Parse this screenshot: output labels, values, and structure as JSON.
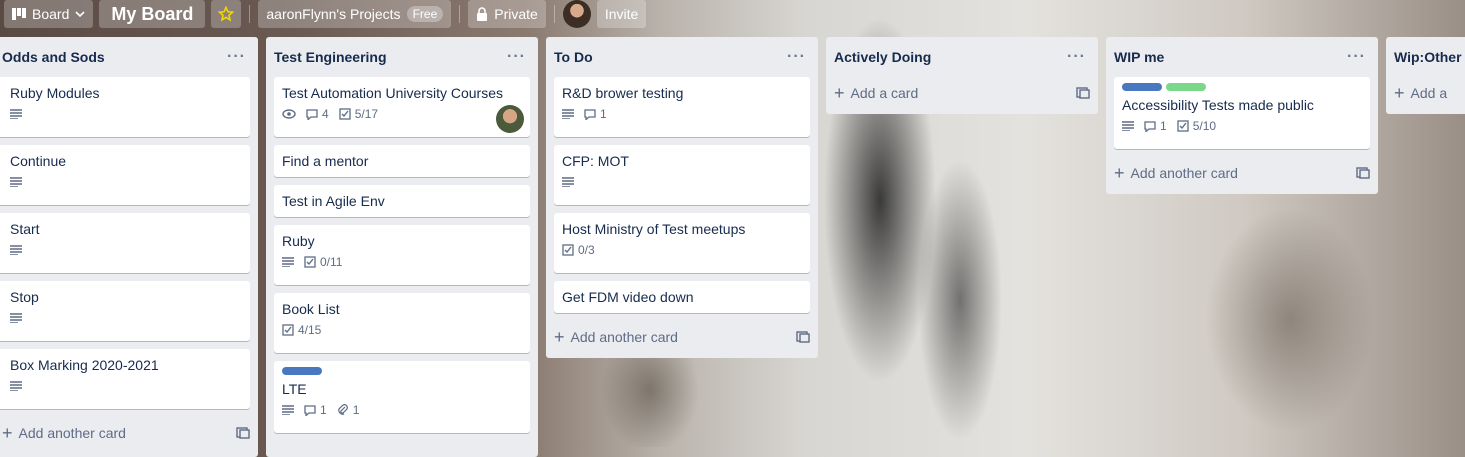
{
  "topbar": {
    "board_switch": "Board",
    "board_title": "My Board",
    "workspace": "aaronFlynn's Projects",
    "workspace_badge": "Free",
    "visibility": "Private",
    "invite": "Invite"
  },
  "lists": [
    {
      "name": "Odds and Sods",
      "cards": [
        {
          "title": "Ruby Modules"
        },
        {
          "title": "Continue"
        },
        {
          "title": "Start"
        },
        {
          "title": "Stop"
        },
        {
          "title": "Box Marking 2020-2021"
        }
      ],
      "add": "Add another card"
    },
    {
      "name": "Test Engineering",
      "cards": [
        {
          "title": "Test Automation University Courses",
          "comments": "4",
          "checklist": "5/17"
        },
        {
          "title": "Find a mentor"
        },
        {
          "title": "Test in Agile Env"
        },
        {
          "title": "Ruby",
          "checklist": "0/11"
        },
        {
          "title": "Book List",
          "checklist": "4/15"
        },
        {
          "title": "LTE",
          "comments": "1",
          "attachments": "1"
        }
      ]
    },
    {
      "name": "To Do",
      "cards": [
        {
          "title": "R&D brower testing",
          "comments": "1"
        },
        {
          "title": "CFP: MOT"
        },
        {
          "title": "Host Ministry of Test meetups",
          "checklist": "0/3"
        },
        {
          "title": "Get FDM video down"
        }
      ],
      "add": "Add another card"
    },
    {
      "name": "Actively Doing",
      "add": "Add a card"
    },
    {
      "name": "WIP me",
      "cards": [
        {
          "title": "Accessibility Tests made public",
          "comments": "1",
          "checklist": "5/10"
        }
      ],
      "add": "Add another card"
    },
    {
      "name": "Wip:Other",
      "add": "Add a"
    }
  ],
  "colors": {
    "label_blue": "#4a78c0",
    "label_green": "#7bd88a",
    "list_bg": "#ebecf0"
  }
}
